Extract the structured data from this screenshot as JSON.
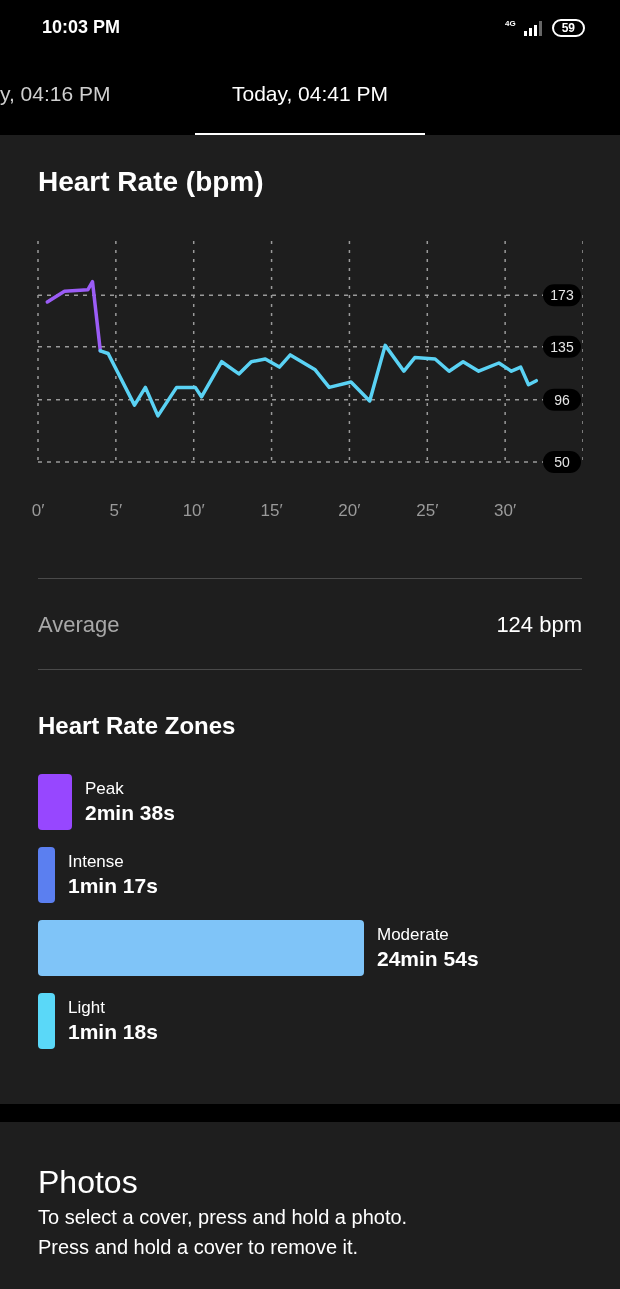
{
  "status_bar": {
    "time": "10:03 PM",
    "network": "4G",
    "battery": "59"
  },
  "tabs": [
    {
      "label": "y, 04:16 PM",
      "selected": false
    },
    {
      "label": "Today, 04:41 PM",
      "selected": true
    }
  ],
  "heart_rate": {
    "title": "Heart Rate (bpm)",
    "chart_data": {
      "type": "line",
      "grid": true,
      "xlim": [
        0,
        35
      ],
      "ylim": [
        50,
        213
      ],
      "xticks": [
        {
          "value": 0,
          "label": "0′"
        },
        {
          "value": 5,
          "label": "5′"
        },
        {
          "value": 10,
          "label": "10′"
        },
        {
          "value": 15,
          "label": "15′"
        },
        {
          "value": 20,
          "label": "20′"
        },
        {
          "value": 25,
          "label": "25′"
        },
        {
          "value": 30,
          "label": "30′"
        }
      ],
      "yticks": [
        173,
        135,
        96,
        50
      ],
      "x": [
        0.6,
        1.7,
        3.2,
        3.5,
        4.0,
        4.5,
        6.2,
        6.9,
        7.7,
        8.9,
        10.1,
        10.5,
        11.8,
        12.9,
        13.7,
        14.6,
        15.5,
        16.2,
        17.8,
        18.7,
        20.1,
        21.3,
        22.3,
        23.5,
        24.2,
        25.5,
        26.4,
        27.3,
        28.3,
        29.6,
        30.4,
        31.0,
        31.5,
        32.0
      ],
      "series": [
        {
          "color": "#9b5cf6",
          "values": [
            168,
            176,
            177,
            183,
            132,
            null,
            null,
            null,
            null,
            null,
            null,
            null,
            null,
            null,
            null,
            null,
            null,
            null,
            null,
            null,
            null,
            null,
            null,
            null,
            null,
            null,
            null,
            null,
            null,
            null,
            null,
            null,
            null,
            null
          ]
        },
        {
          "color": "#5ad2f4",
          "values": [
            null,
            null,
            null,
            null,
            132,
            130,
            92,
            105,
            84,
            105,
            105,
            98,
            124,
            115,
            124,
            126,
            120,
            129,
            118,
            105,
            109,
            95,
            136,
            117,
            127,
            126,
            117,
            124,
            117,
            123,
            117,
            120,
            107,
            110
          ]
        }
      ]
    }
  },
  "average": {
    "label": "Average",
    "value": "124 bpm"
  },
  "zones": {
    "title": "Heart Rate Zones",
    "items": [
      {
        "name": "Peak",
        "time": "2min 38s",
        "color": "#9747ff"
      },
      {
        "name": "Intense",
        "time": "1min 17s",
        "color": "#5b7ff0"
      },
      {
        "name": "Moderate",
        "time": "24min 54s",
        "color": "#7fc4f8"
      },
      {
        "name": "Light",
        "time": "1min 18s",
        "color": "#5ad8f8"
      }
    ]
  },
  "photos": {
    "title": "Photos",
    "text": "To select a cover, press and hold a photo.\nPress and hold a cover to remove it."
  }
}
